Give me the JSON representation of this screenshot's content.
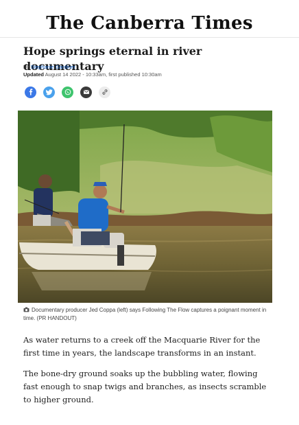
{
  "masthead": {
    "logo_text": "The Canberra Times"
  },
  "article": {
    "headline": "Hope springs eternal in river documentary",
    "byline_prefix": "By",
    "author": "Stephanie Gardiner",
    "updated_label": "Updated",
    "updated_text": "August 14 2022 - 10:33am, first published 10:30am",
    "share": [
      {
        "name": "facebook",
        "glyph": "f",
        "color": "#3b78e7"
      },
      {
        "name": "twitter",
        "glyph": "t",
        "color": "#4aa1ec"
      },
      {
        "name": "whatsapp",
        "glyph": "w",
        "color": "#3ec46d"
      },
      {
        "name": "email",
        "glyph": "e",
        "color": "#3a3a3a"
      },
      {
        "name": "link",
        "glyph": "l",
        "color": "#e9e9e9"
      }
    ],
    "caption": "Documentary producer Jed Coppa (left) says Following The Flow captures a poignant moment in time. (PR HANDOUT)",
    "paragraphs": [
      "As water returns to a creek off the Macquarie River for the first time in years, the landscape transforms in an instant.",
      "The bone-dry ground soaks up the bubbling water, flowing fast enough to snap twigs and branches, as insects scramble to higher ground."
    ]
  }
}
